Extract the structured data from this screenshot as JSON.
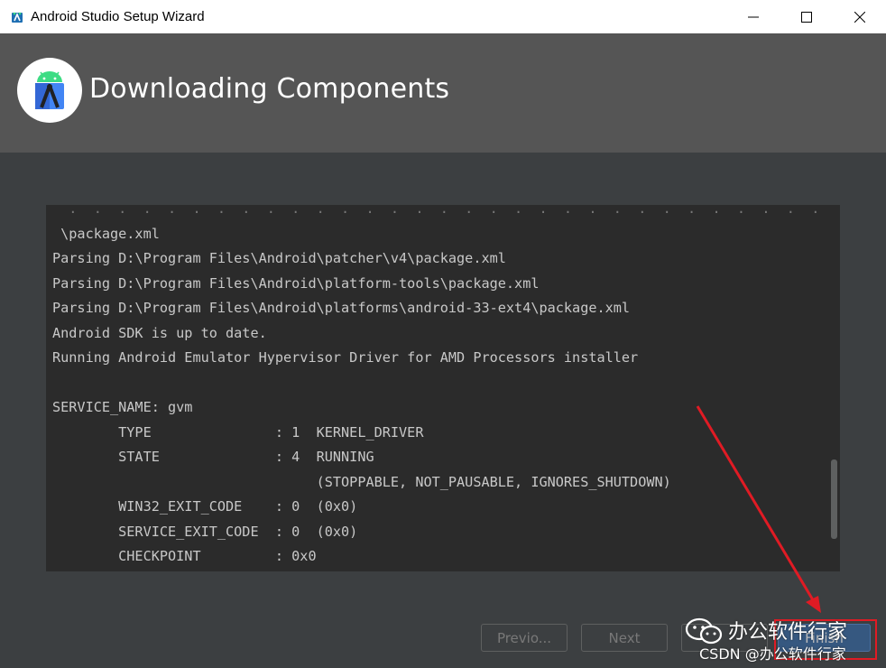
{
  "window": {
    "title": "Android Studio Setup Wizard"
  },
  "header": {
    "title": "Downloading Components"
  },
  "console": {
    "lines": [
      "  .  .  .  .  .  .  .  .  .  .  .  .  .  .  .  .  .  .  .  .  .  .  .  .  .  .  .  .  .  .  .",
      " \\package.xml",
      "Parsing D:\\Program Files\\Android\\patcher\\v4\\package.xml",
      "Parsing D:\\Program Files\\Android\\platform-tools\\package.xml",
      "Parsing D:\\Program Files\\Android\\platforms\\android-33-ext4\\package.xml",
      "Android SDK is up to date.",
      "Running Android Emulator Hypervisor Driver for AMD Processors installer",
      "",
      "SERVICE_NAME: gvm",
      "        TYPE               : 1  KERNEL_DRIVER",
      "        STATE              : 4  RUNNING",
      "                                (STOPPABLE, NOT_PAUSABLE, IGNORES_SHUTDOWN)",
      "        WIN32_EXIT_CODE    : 0  (0x0)",
      "        SERVICE_EXIT_CODE  : 0  (0x0)",
      "        CHECKPOINT         : 0x0"
    ]
  },
  "buttons": {
    "previous": "Previo...",
    "next": "Next",
    "cancel": "",
    "finish": "Finish"
  },
  "watermark": {
    "name": "办公软件行家",
    "csdn": "CSDN @办公软件行家"
  },
  "colors": {
    "header_bg": "#555555",
    "content_bg": "#3c3f41",
    "console_bg": "#2b2b2b",
    "console_text": "#c8c8c8",
    "annotation": "#e01b24",
    "android_green": "#3ddc84"
  },
  "icons": {
    "app": "android-studio-icon",
    "logo": "android-studio-logo",
    "minimize": "minimize-icon",
    "maximize": "maximize-icon",
    "close": "close-icon",
    "wechat": "wechat-icon"
  }
}
